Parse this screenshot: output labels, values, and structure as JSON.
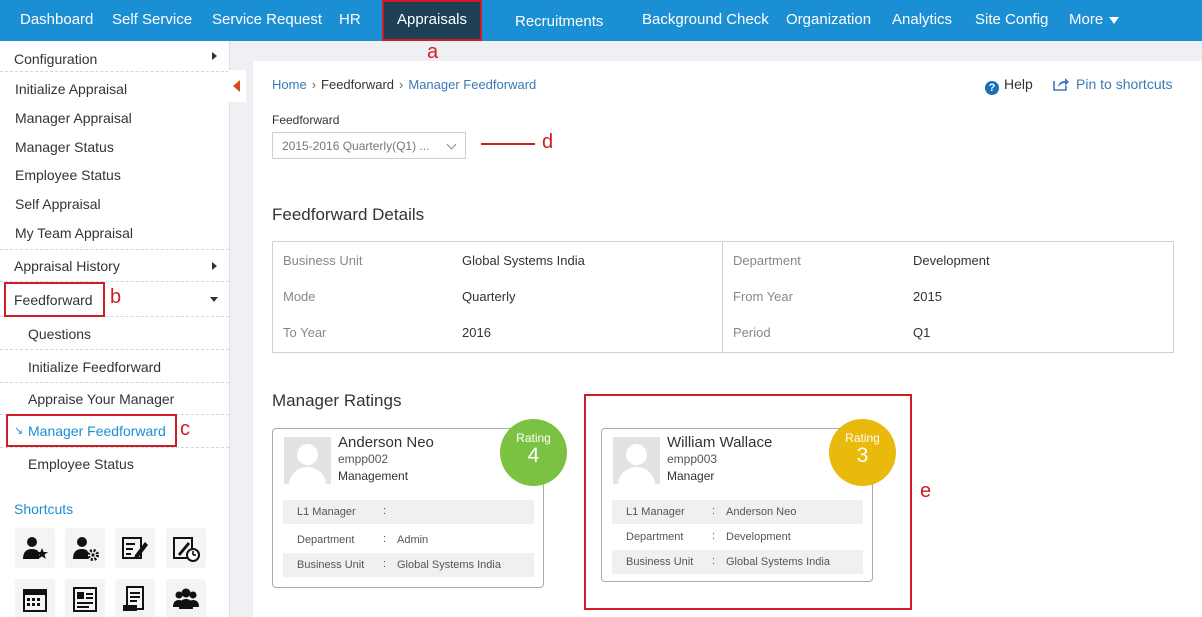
{
  "nav": {
    "items": [
      "Dashboard",
      "Self Service",
      "Service Request",
      "HR",
      "Appraisals",
      "Recruitments",
      "Background Check",
      "Organization",
      "Analytics",
      "Site Config",
      "More"
    ]
  },
  "sidebar": {
    "items": [
      "Configuration",
      "Initialize Appraisal",
      "Manager Appraisal",
      "Manager Status",
      "Employee Status",
      "Self Appraisal",
      "My Team Appraisal",
      "Appraisal History",
      "Feedforward",
      "Questions",
      "Initialize Feedforward",
      "Appraise Your Manager",
      "Manager Feedforward",
      "Employee Status"
    ],
    "shortcuts_title": "Shortcuts"
  },
  "annotations": {
    "a": "a",
    "b": "b",
    "c": "c",
    "d": "d",
    "e": "e"
  },
  "breadcrumb": {
    "home": "Home",
    "sep": "›",
    "feedforward": "Feedforward",
    "current": "Manager Feedforward"
  },
  "header_links": {
    "help": "Help",
    "pin": "Pin to shortcuts"
  },
  "filter": {
    "label": "Feedforward",
    "selected": "2015-2016 Quarterly(Q1) ..."
  },
  "details": {
    "title": "Feedforward Details",
    "rows": [
      {
        "l1": "Business Unit",
        "v1": "Global Systems India",
        "l2": "Department",
        "v2": "Development"
      },
      {
        "l1": "Mode",
        "v1": "Quarterly",
        "l2": "From Year",
        "v2": "2015"
      },
      {
        "l1": "To Year",
        "v1": "2016",
        "l2": "Period",
        "v2": "Q1"
      }
    ]
  },
  "ratings": {
    "title": "Manager Ratings",
    "cards": [
      {
        "name": "Anderson Neo",
        "id": "empp002",
        "role": "Management",
        "rating_label": "Rating",
        "rating": "4",
        "badge_color": "#7cc242",
        "info": [
          {
            "key": "L1 Manager",
            "colon": ":",
            "value": ""
          },
          {
            "key": "Department",
            "colon": ":",
            "value": "Admin"
          },
          {
            "key": "Business Unit",
            "colon": ":",
            "value": "Global Systems India"
          }
        ]
      },
      {
        "name": "William Wallace",
        "id": "empp003",
        "role": "Manager",
        "rating_label": "Rating",
        "rating": "3",
        "badge_color": "#e9b90b",
        "info": [
          {
            "key": "L1 Manager",
            "colon": ":",
            "value": "Anderson Neo"
          },
          {
            "key": "Department",
            "colon": ":",
            "value": "Development"
          },
          {
            "key": "Business Unit",
            "colon": ":",
            "value": "Global Systems India"
          }
        ]
      }
    ]
  },
  "colors": {
    "nav_bg": "#1b8fd3",
    "nav_active": "#1d4057",
    "annotation_red": "#d01c24",
    "link": "#3a7ab8"
  },
  "shortcut_icons": [
    "user-star-icon",
    "user-gear-icon",
    "form-edit-icon",
    "form-clock-icon",
    "calendar-icon",
    "id-card-icon",
    "document-icon",
    "group-icon"
  ]
}
